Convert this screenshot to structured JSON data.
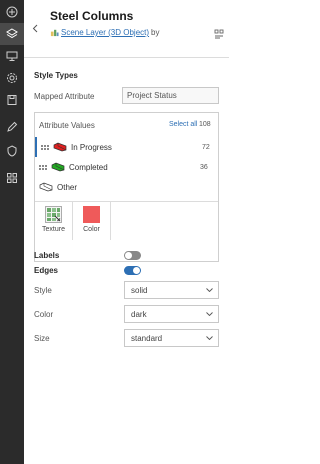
{
  "header": {
    "title": "Steel Columns",
    "layer_link": "Scene Layer (3D Object)",
    "by_text": "by"
  },
  "style_types": {
    "section_title": "Style Types",
    "mapped_attribute_label": "Mapped Attribute",
    "mapped_attribute_value": "Project Status"
  },
  "attribute_values": {
    "heading": "Attribute Values",
    "select_all": "Select all",
    "total": "108",
    "items": [
      {
        "label": "In Progress",
        "count": "72",
        "color": "#e02020"
      },
      {
        "label": "Completed",
        "count": "36",
        "color": "#22a822"
      },
      {
        "label": "Other",
        "count": "",
        "color": "#ffffff"
      }
    ],
    "tools": [
      {
        "label": "Texture"
      },
      {
        "label": "Color",
        "color": "#ef5a5a"
      }
    ]
  },
  "options": {
    "labels_label": "Labels",
    "labels_on": false,
    "edges_label": "Edges",
    "edges_on": true,
    "style_label": "Style",
    "style_value": "solid",
    "color_label": "Color",
    "color_value": "dark",
    "size_label": "Size",
    "size_value": "standard"
  },
  "colors": {
    "accent": "#2d6fb4",
    "sidebar": "#2b2b2b"
  },
  "icons": [
    "add-icon",
    "layers-icon",
    "monitor-icon",
    "settings-icon",
    "save-icon",
    "edit-icon",
    "shield-icon",
    "grid-icon",
    "back-icon",
    "scene-layer-icon",
    "legend-icon",
    "chevron-down-icon",
    "grip-icon",
    "texture-icon"
  ]
}
